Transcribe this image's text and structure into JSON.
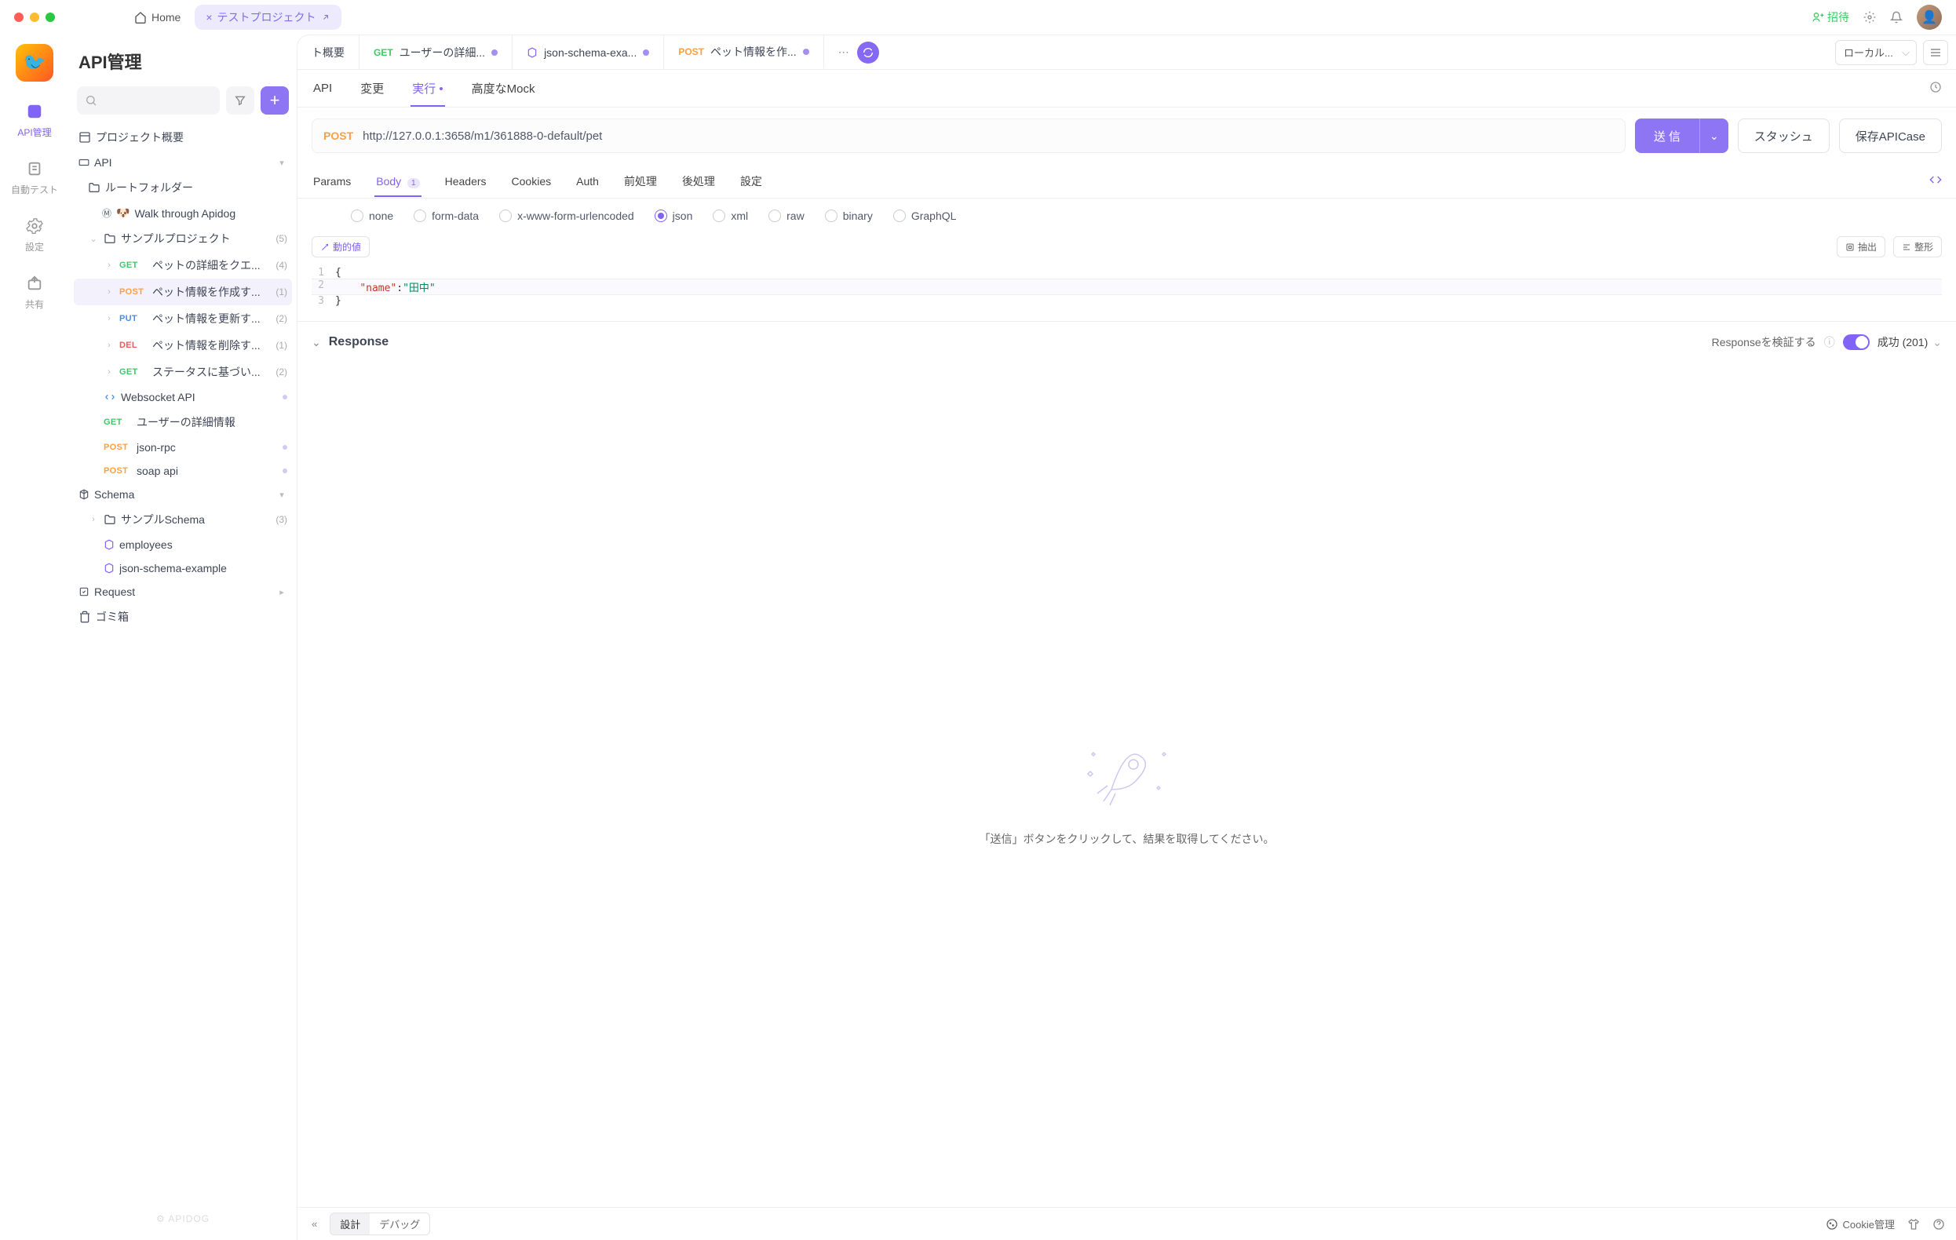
{
  "titlebar": {
    "home": "Home",
    "project_tab": "テストプロジェクト",
    "invite": "招待"
  },
  "rail": {
    "api_mgmt": "API管理",
    "auto_test": "自動テスト",
    "settings": "設定",
    "share": "共有"
  },
  "sidebar": {
    "title": "API管理",
    "project_overview": "プロジェクト概要",
    "api_section": "API",
    "root_folder": "ルートフォルダー",
    "walk_through": "Walk through Apidog",
    "sample_project": "サンプルプロジェクト",
    "sample_count": "(5)",
    "items": [
      {
        "method": "GET",
        "method_cls": "method-get",
        "label": "ペットの詳細をクエ...",
        "count": "(4)"
      },
      {
        "method": "POST",
        "method_cls": "method-post",
        "label": "ペット情報を作成す...",
        "count": "(1)"
      },
      {
        "method": "PUT",
        "method_cls": "method-put",
        "label": "ペット情報を更新す...",
        "count": "(2)"
      },
      {
        "method": "DEL",
        "method_cls": "method-del",
        "label": "ペット情報を削除す...",
        "count": "(1)"
      },
      {
        "method": "GET",
        "method_cls": "method-get",
        "label": "ステータスに基づい...",
        "count": "(2)"
      }
    ],
    "websocket": "Websocket API",
    "user_detail": {
      "method": "GET",
      "label": "ユーザーの詳細情報"
    },
    "jsonrpc": {
      "method": "POST",
      "label": "json-rpc"
    },
    "soap": {
      "method": "POST",
      "label": "soap api"
    },
    "schema_section": "Schema",
    "sample_schema": "サンプルSchema",
    "sample_schema_count": "(3)",
    "employees": "employees",
    "json_schema_ex": "json-schema-example",
    "request_section": "Request",
    "trash": "ゴミ箱",
    "watermark": "⚙ APIDOG"
  },
  "tabs": [
    {
      "prefix": "",
      "method": "",
      "label": "ト概要",
      "dirty": false,
      "show_method": false
    },
    {
      "prefix": "",
      "method": "GET",
      "method_cls": "method-get",
      "label": "ユーザーの詳細...",
      "dirty": true,
      "show_method": true
    },
    {
      "prefix": "",
      "icon": "cube",
      "label": "json-schema-exa...",
      "dirty": true,
      "show_method": false
    },
    {
      "prefix": "",
      "method": "POST",
      "method_cls": "method-post",
      "label": "ペット情報を作...",
      "dirty": true,
      "show_method": true
    }
  ],
  "env": "ローカル...",
  "subtabs": {
    "api": "API",
    "change": "変更",
    "run": "実行",
    "mock": "高度なMock"
  },
  "urlbar": {
    "method": "POST",
    "url": "http://127.0.0.1:3658/m1/361888-0-default/pet",
    "send": "送 信",
    "stash": "スタッシュ",
    "save_case": "保存APICase"
  },
  "reqtabs": {
    "params": "Params",
    "body": "Body",
    "body_count": "1",
    "headers": "Headers",
    "cookies": "Cookies",
    "auth": "Auth",
    "pre": "前処理",
    "post": "後処理",
    "settings": "設定"
  },
  "body_types": {
    "none": "none",
    "form": "form-data",
    "xform": "x-www-form-urlencoded",
    "json": "json",
    "xml": "xml",
    "raw": "raw",
    "binary": "binary",
    "graphql": "GraphQL"
  },
  "editor_toolbar": {
    "dynamic": "動的値",
    "extract": "抽出",
    "format": "整形"
  },
  "editor": {
    "lines": [
      {
        "n": "1",
        "content": "{",
        "type": "brace"
      },
      {
        "n": "2",
        "key": "\"name\"",
        "sep": ":",
        "val": "\"田中\"",
        "type": "kv"
      },
      {
        "n": "3",
        "content": "}",
        "type": "brace"
      }
    ]
  },
  "response": {
    "title": "Response",
    "verify": "Responseを検証する",
    "status": "成功 (201)",
    "empty_msg": "「送信」ボタンをクリックして、結果を取得してください。"
  },
  "bottombar": {
    "design": "設計",
    "debug": "デバッグ",
    "cookie_mgmt": "Cookie管理"
  }
}
